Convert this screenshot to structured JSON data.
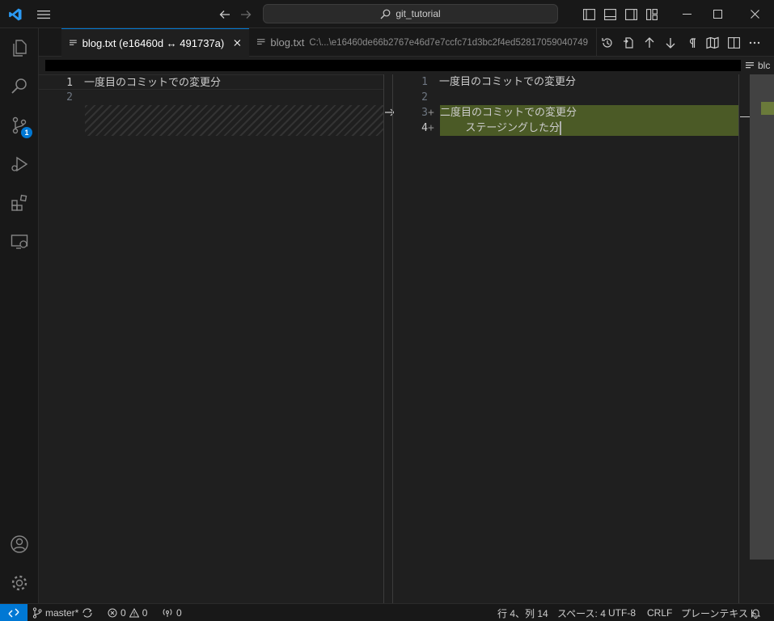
{
  "titlebar": {
    "search_text": "git_tutorial"
  },
  "activitybar": {
    "items": [
      {
        "name": "explorer",
        "icon": "files-icon"
      },
      {
        "name": "search",
        "icon": "search-icon"
      },
      {
        "name": "source-control",
        "icon": "source-control-icon",
        "badge": "1"
      },
      {
        "name": "run-debug",
        "icon": "run-debug-icon"
      },
      {
        "name": "extensions",
        "icon": "extensions-icon"
      },
      {
        "name": "remote-explorer",
        "icon": "remote-explorer-icon"
      }
    ],
    "bottom": [
      {
        "name": "accounts",
        "icon": "account-icon"
      },
      {
        "name": "manage",
        "icon": "gear-icon"
      }
    ]
  },
  "tabs": [
    {
      "label": "blog.txt (e16460d ↔ 491737a)",
      "active": true
    },
    {
      "label": "blog.txt",
      "description": "C:\\...\\e16460de66b2767e46d7e7ccfc71d3bc2f4ed52817059040749",
      "active": false
    }
  ],
  "breadcrumb": {
    "file": "blc"
  },
  "diff": {
    "left": {
      "lines": [
        {
          "num": "1",
          "text": "一度目のコミットでの変更分"
        },
        {
          "num": "2",
          "text": ""
        }
      ]
    },
    "right": {
      "lines": [
        {
          "num": "1",
          "text": "一度目のコミットでの変更分"
        },
        {
          "num": "2",
          "text": ""
        },
        {
          "num": "3",
          "marker": "+",
          "text": "二度目のコミットでの変更分"
        },
        {
          "num": "4",
          "marker": "+",
          "text": "\tステージングした分"
        }
      ]
    }
  },
  "statusbar": {
    "branch": "master*",
    "errors": "0",
    "warnings": "0",
    "ports": "0",
    "position": "行 4、列 14",
    "spaces": "スペース: 4",
    "encoding": "UTF-8",
    "eol": "CRLF",
    "language": "プレーンテキスト"
  },
  "colors": {
    "accent": "#0078d4",
    "inserted": "#4b5a26",
    "background": "#1f1f1f"
  }
}
